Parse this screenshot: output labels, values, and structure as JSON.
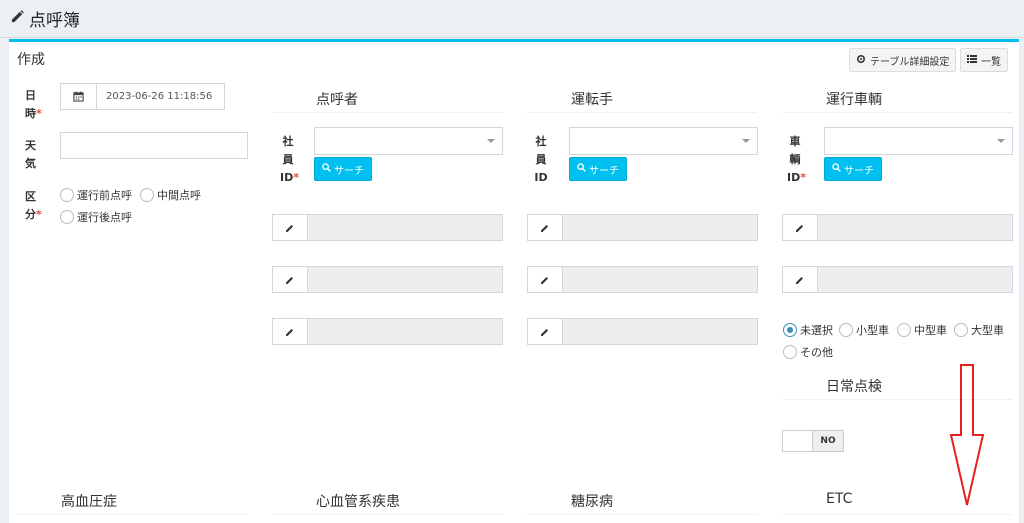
{
  "page": {
    "title": "点呼簿",
    "icon": "pencil-icon"
  },
  "box": {
    "title": "作成",
    "table_settings_label": "テーブル詳細設定",
    "list_label": "一覧"
  },
  "form": {
    "datetime_label_1": "日",
    "datetime_label_2": "時",
    "datetime_value": "2023-06-26 11:18:56",
    "weather_label_1": "天",
    "weather_label_2": "気",
    "weather_value": "",
    "kubun_label_1": "区",
    "kubun_label_2": "分",
    "kubun_options": [
      "運行前点呼",
      "中間点呼",
      "運行後点呼"
    ],
    "required_mark": "*"
  },
  "sections": {
    "tenkosha": "点呼者",
    "driver": "運転手",
    "vehicle": "運行車輌",
    "daily_check": "日常点検",
    "hypertension": "高血圧症",
    "cardio": "心血管系疾患",
    "diabetes": "糖尿病",
    "etc": "ETC"
  },
  "labels": {
    "employee_id_1": "社",
    "employee_id_2": "員",
    "employee_id_3": "ID",
    "vehicle_id_1": "車",
    "vehicle_id_2": "輌",
    "vehicle_id_3": "ID",
    "search_button": "サーチ"
  },
  "vehicle_types": {
    "options": [
      "未選択",
      "小型車",
      "中型車",
      "大型車",
      "その他"
    ],
    "selected": "未選択"
  },
  "daily_check_toggle": "NO",
  "colors": {
    "accent": "#00c0ef",
    "required": "#dd4b39",
    "radio_checked": "#3c8dbc",
    "annotation_arrow": "#e82020"
  }
}
